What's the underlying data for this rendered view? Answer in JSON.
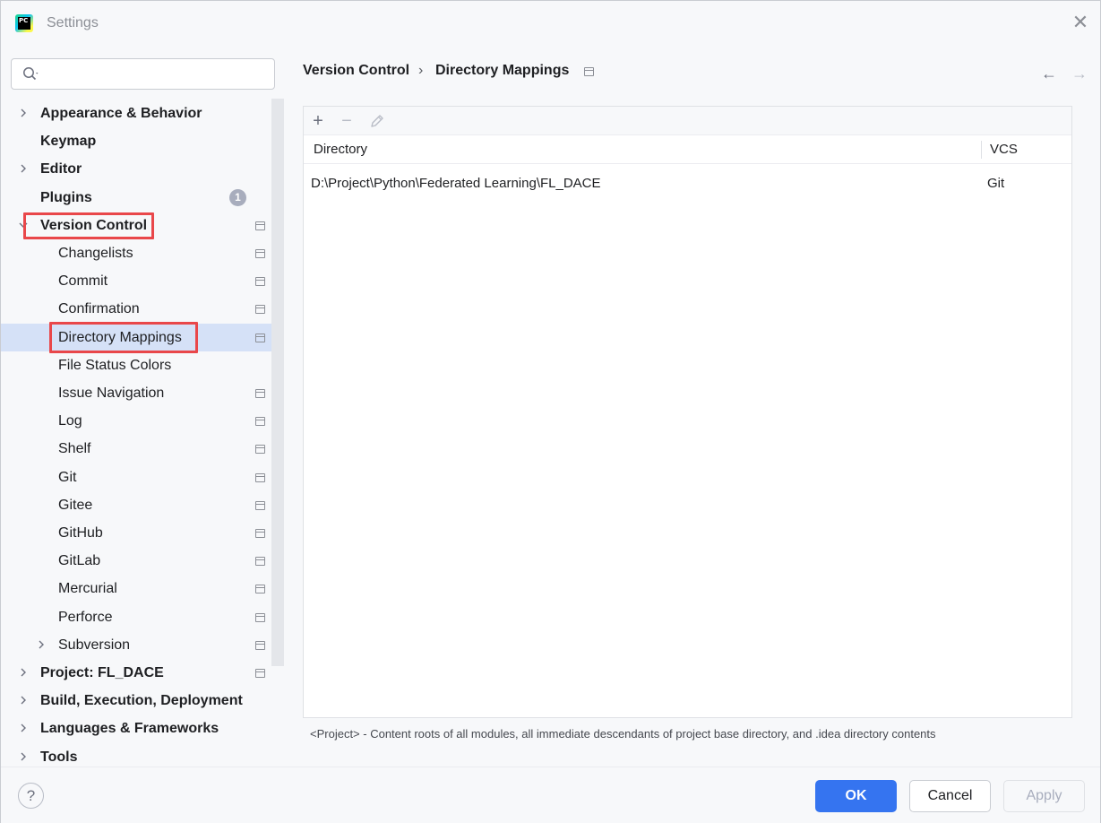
{
  "window": {
    "title": "Settings",
    "app_icon_text": "PC",
    "close_symbol": "✕"
  },
  "search": {
    "value": "",
    "placeholder": ""
  },
  "sidebar": {
    "items": [
      {
        "label": "Appearance & Behavior",
        "level": 0,
        "expandable": true,
        "expanded": false,
        "project_icon": false
      },
      {
        "label": "Keymap",
        "level": 0,
        "expandable": false,
        "project_icon": false
      },
      {
        "label": "Editor",
        "level": 0,
        "expandable": true,
        "expanded": false,
        "project_icon": false
      },
      {
        "label": "Plugins",
        "level": 0,
        "expandable": false,
        "project_icon": false,
        "badge": "1"
      },
      {
        "label": "Version Control",
        "level": 0,
        "expandable": true,
        "expanded": true,
        "project_icon": true
      },
      {
        "label": "Changelists",
        "level": 1,
        "project_icon": true
      },
      {
        "label": "Commit",
        "level": 1,
        "project_icon": true
      },
      {
        "label": "Confirmation",
        "level": 1,
        "project_icon": true
      },
      {
        "label": "Directory Mappings",
        "level": 1,
        "project_icon": true,
        "selected": true
      },
      {
        "label": "File Status Colors",
        "level": 1,
        "project_icon": false
      },
      {
        "label": "Issue Navigation",
        "level": 1,
        "project_icon": true
      },
      {
        "label": "Log",
        "level": 1,
        "project_icon": true
      },
      {
        "label": "Shelf",
        "level": 1,
        "project_icon": true
      },
      {
        "label": "Git",
        "level": 1,
        "project_icon": true
      },
      {
        "label": "Gitee",
        "level": 1,
        "project_icon": true
      },
      {
        "label": "GitHub",
        "level": 1,
        "project_icon": true
      },
      {
        "label": "GitLab",
        "level": 1,
        "project_icon": true
      },
      {
        "label": "Mercurial",
        "level": 1,
        "project_icon": true
      },
      {
        "label": "Perforce",
        "level": 1,
        "project_icon": true
      },
      {
        "label": "Subversion",
        "level": 1,
        "expandable": true,
        "expanded": false,
        "project_icon": true
      },
      {
        "label": "Project: FL_DACE",
        "level": 0,
        "expandable": true,
        "expanded": false,
        "project_icon": true
      },
      {
        "label": "Build, Execution, Deployment",
        "level": 0,
        "expandable": true,
        "expanded": false,
        "project_icon": false
      },
      {
        "label": "Languages & Frameworks",
        "level": 0,
        "expandable": true,
        "expanded": false,
        "project_icon": false
      },
      {
        "label": "Tools",
        "level": 0,
        "expandable": true,
        "expanded": false,
        "project_icon": false
      }
    ]
  },
  "breadcrumb": {
    "parent": "Version Control",
    "separator": "›",
    "current": "Directory Mappings"
  },
  "nav": {
    "back_symbol": "←",
    "forward_symbol": "→"
  },
  "toolbar": {
    "add_symbol": "+",
    "remove_symbol": "−",
    "edit_icon": "pencil-icon"
  },
  "table": {
    "columns": [
      "Directory",
      "VCS"
    ],
    "rows": [
      {
        "directory": "D:\\Project\\Python\\Federated Learning\\FL_DACE",
        "vcs": "Git"
      }
    ]
  },
  "hint": "<Project> - Content roots of all modules, all immediate descendants of project base directory, and .idea directory contents",
  "footer": {
    "help_label": "?",
    "ok_label": "OK",
    "cancel_label": "Cancel",
    "apply_label": "Apply"
  },
  "colors": {
    "accent": "#3574f0",
    "selection": "#d5e1f7",
    "highlight_box": "#e9474a",
    "badge": "#a8adbd"
  }
}
